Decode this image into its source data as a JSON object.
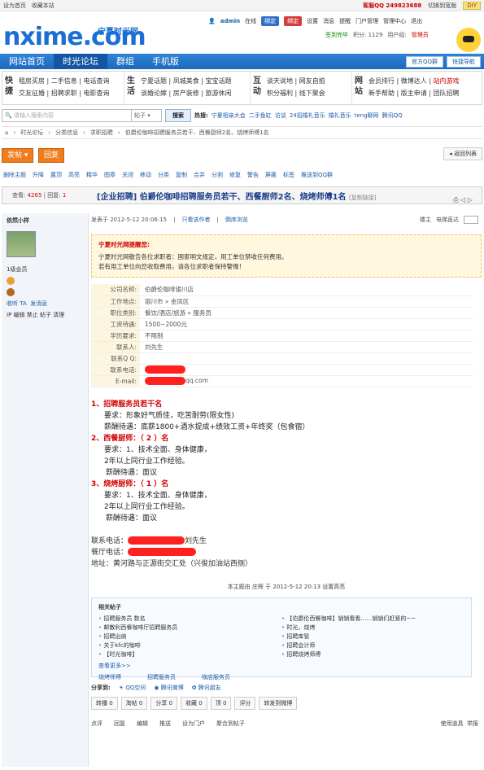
{
  "topbar": {
    "set_home": "设为首页",
    "favorite": "收藏本站",
    "qq_label": "客服QQ 249823688",
    "style": "切换到宽版",
    "diy": "DIY"
  },
  "header": {
    "logo": "nxime.com",
    "logo_sub": "宁夏时光网"
  },
  "user": {
    "name": "admin",
    "status": "在线",
    "btn1": "绑定",
    "btn2": "绑定",
    "links": [
      "设置",
      "消息",
      "提醒",
      "门户管理",
      "管理中心",
      "退出"
    ],
    "signin": "签到完毕",
    "points": "积分: 1129",
    "group_label": "用户组:",
    "group": "管理员"
  },
  "nav": {
    "items": [
      "网站首页",
      "时光论坛",
      "群组",
      "手机版"
    ],
    "btn_qq": "官方QQ群",
    "btn_quick": "快捷导航"
  },
  "quick": [
    {
      "head": "快捷",
      "rows": [
        "租房买房 | 二手信息 | 电话查询",
        "交友征婚 | 招聘求职 | 电影查询"
      ]
    },
    {
      "head": "生活",
      "rows": [
        "宁夏话题 | 凤城美食 | 宝宝话题",
        "谈婚论嫁 | 房产装修 | 旅游休闲"
      ]
    },
    {
      "head": "互动",
      "rows": [
        "谈天说地 | 网友自拍",
        "积分福利 | 线下聚会"
      ]
    },
    {
      "head": "网站",
      "rows": [
        "会员排行 | 微博达人 | ",
        "新手帮助 | 版主申请 | 团队招聘"
      ],
      "red": "站内游戏"
    }
  ],
  "search": {
    "placeholder": "请输入搜索内容",
    "type": "帖子",
    "button": "搜索",
    "hot_label": "热搜:",
    "hot": [
      "宁夏相亲大会",
      "二手鱼缸",
      "访谈",
      "24招婚礼音乐",
      "婚礼音乐",
      "teng聊网",
      "腾讯QQ"
    ]
  },
  "crumb": [
    "时光论坛",
    "分类信息",
    "求职招聘",
    "伯爵伦咖啡招聘服务员若干、西餐厨师2名、烧烤师傅1名"
  ],
  "postbar": {
    "post": "发帖",
    "reply": "回复",
    "back": "返回列表"
  },
  "mod": [
    "删除主题",
    "升降",
    "置顶",
    "高亮",
    "精华",
    "图章",
    "关闭",
    "移动",
    "分类",
    "复制",
    "合并",
    "分割",
    "修复",
    "警告",
    "屏蔽",
    "标签",
    "推送到QQ群"
  ],
  "thread": {
    "views_label": "查看:",
    "views": "4265",
    "replies_label": "回复:",
    "replies": "1",
    "title": "[企业招聘] 伯爵伦咖啡招聘服务员若干、西餐厨师2名、烧烤师傅1名",
    "copy": "[复制链接]"
  },
  "author": {
    "name": "依然小样",
    "level": "1级会员",
    "actions": [
      "收听 TA",
      "发消息"
    ],
    "admin": "IP 编辑 禁止 帖子 清理"
  },
  "postinfo": {
    "posted": "发表于 2012-5-12 20:06:15",
    "only": "只看该作者",
    "order": "倒序浏览",
    "floor": "楼主",
    "jump": "电梯直达"
  },
  "notice": {
    "title": "宁夏时光网提醒您:",
    "l1": "宁夏时光网敬告各位求职者：国家明文规定，用工单位禁收任何费用。",
    "l2": "若有用工单位向您收取费用，请各位求职者保持警惕！"
  },
  "info": [
    {
      "k": "公司名称:",
      "v": "伯爵伦咖啡银川店"
    },
    {
      "k": "工作地点:",
      "v": "银川市 » 金凤区"
    },
    {
      "k": "职位类别:",
      "v": "餐饮/酒店/旅游 » 服务员"
    },
    {
      "k": "工资待遇:",
      "v": "1500~2000元"
    },
    {
      "k": "学历要求:",
      "v": "不限制"
    },
    {
      "k": "联系人:",
      "v": "刘先生"
    },
    {
      "k": "联系Q Q:",
      "v": ""
    },
    {
      "k": "联系电话:",
      "v": ""
    },
    {
      "k": "E-mail:",
      "v": "qq.com"
    }
  ],
  "body": {
    "h1": "1、招聘服务员若干名",
    "h1a": "要求：形象好气质佳，吃苦耐劳(限女性)",
    "h1b": "薪酬待遇：底薪1800+酒水提成+绩效工资+年终奖（包食宿）",
    "h2": "2、西餐厨师：（ 2 ）名",
    "h2a": "要求：1、技术全面、身体健康，",
    "h2b": "2年以上同行业工作经验。",
    "h2c": "薪酬待遇：面议",
    "h3": "3、烧烤厨师：（ 1 ）名",
    "h3a": "要求：1、技术全面、身体健康，",
    "h3b": "2年以上同行业工作经验。",
    "h3c": "薪酬待遇：面议"
  },
  "contact": {
    "tel_label": "联系电话：",
    "tel_name": "刘先生",
    "rest_label": "餐厅电话：",
    "addr": "地址：黄河路与正源街交汇处（兴俊加油站西侧）"
  },
  "editnote": "本主题由 庄辉 于 2012-5-12 20:13 设置高亮",
  "related": {
    "title": "相关帖子",
    "left": [
      "招聘服务员 数名",
      "邮散利西餐咖啡厅招聘服务员",
      "招聘出纳",
      "关于kfc的咖啡",
      "【时光咖啡】"
    ],
    "right": [
      "【伯爵伦西餐咖啡】销销看看……销销们赶紧的~~",
      "时光，烧烤",
      "招聘库管",
      "招聘会计师",
      "招聘烧烤师傅"
    ],
    "more": "查看更多>>",
    "tags": [
      "烧烤师傅",
      "招聘服务员",
      "咖店服务员"
    ]
  },
  "share": {
    "label": "分享到:",
    "items": [
      "QQ空间",
      "腾讯微博",
      "腾讯朋友"
    ]
  },
  "actions": [
    "转播 0",
    "淘帖 0",
    "分享 0",
    "收藏 0",
    "顶 0",
    "评分",
    "转发到微博"
  ],
  "foot": {
    "items": [
      "点评",
      "回复",
      "编辑",
      "推送",
      "设为门户",
      "聚合到帖子"
    ],
    "tools": "使用道具",
    "report": "举报"
  }
}
